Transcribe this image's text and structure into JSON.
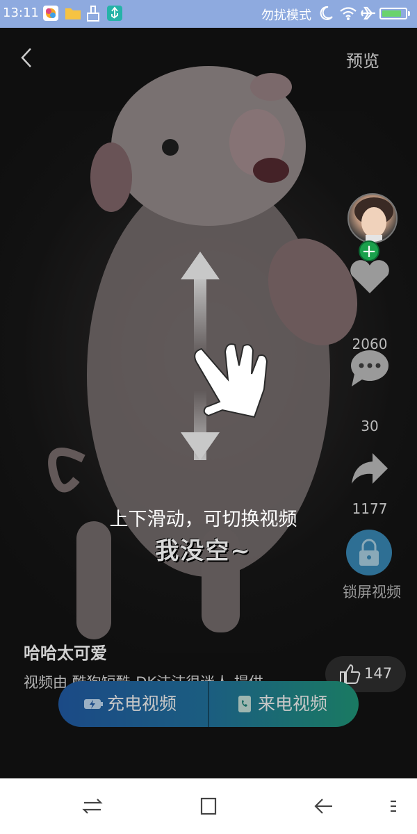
{
  "status_bar": {
    "time": "13:11",
    "right_text": "勿扰模式",
    "icons": [
      "app-store-icon",
      "folder-icon",
      "cleaner-icon",
      "usb-icon",
      "moon-icon",
      "wifi-icon",
      "airplane-icon",
      "battery-icon"
    ],
    "battery_level": 0.85
  },
  "topbar": {
    "back_icon": "chevron-left-icon",
    "preview_label": "预览"
  },
  "swipe_hint": {
    "text": "上下滑动，可切换视频"
  },
  "subtitle": "我没空~",
  "rail": {
    "likes": "2060",
    "comments": "30",
    "shares": "1177",
    "lock_label": "锁屏视频"
  },
  "video_info": {
    "title": "哈哈太可爱",
    "provider": "视频由 酷狗短酷-DK沫沫很迷人 提供",
    "thumbs_count": "147"
  },
  "actions": {
    "charge_label": "充电视频",
    "ringtone_label": "来电视频"
  },
  "colors": {
    "status_bar": "#8eaadf",
    "follow_green": "#1aa04c",
    "lock_blue": "#2e6f94",
    "cta_left": "#1b4a86",
    "cta_right": "#1a7a62"
  }
}
